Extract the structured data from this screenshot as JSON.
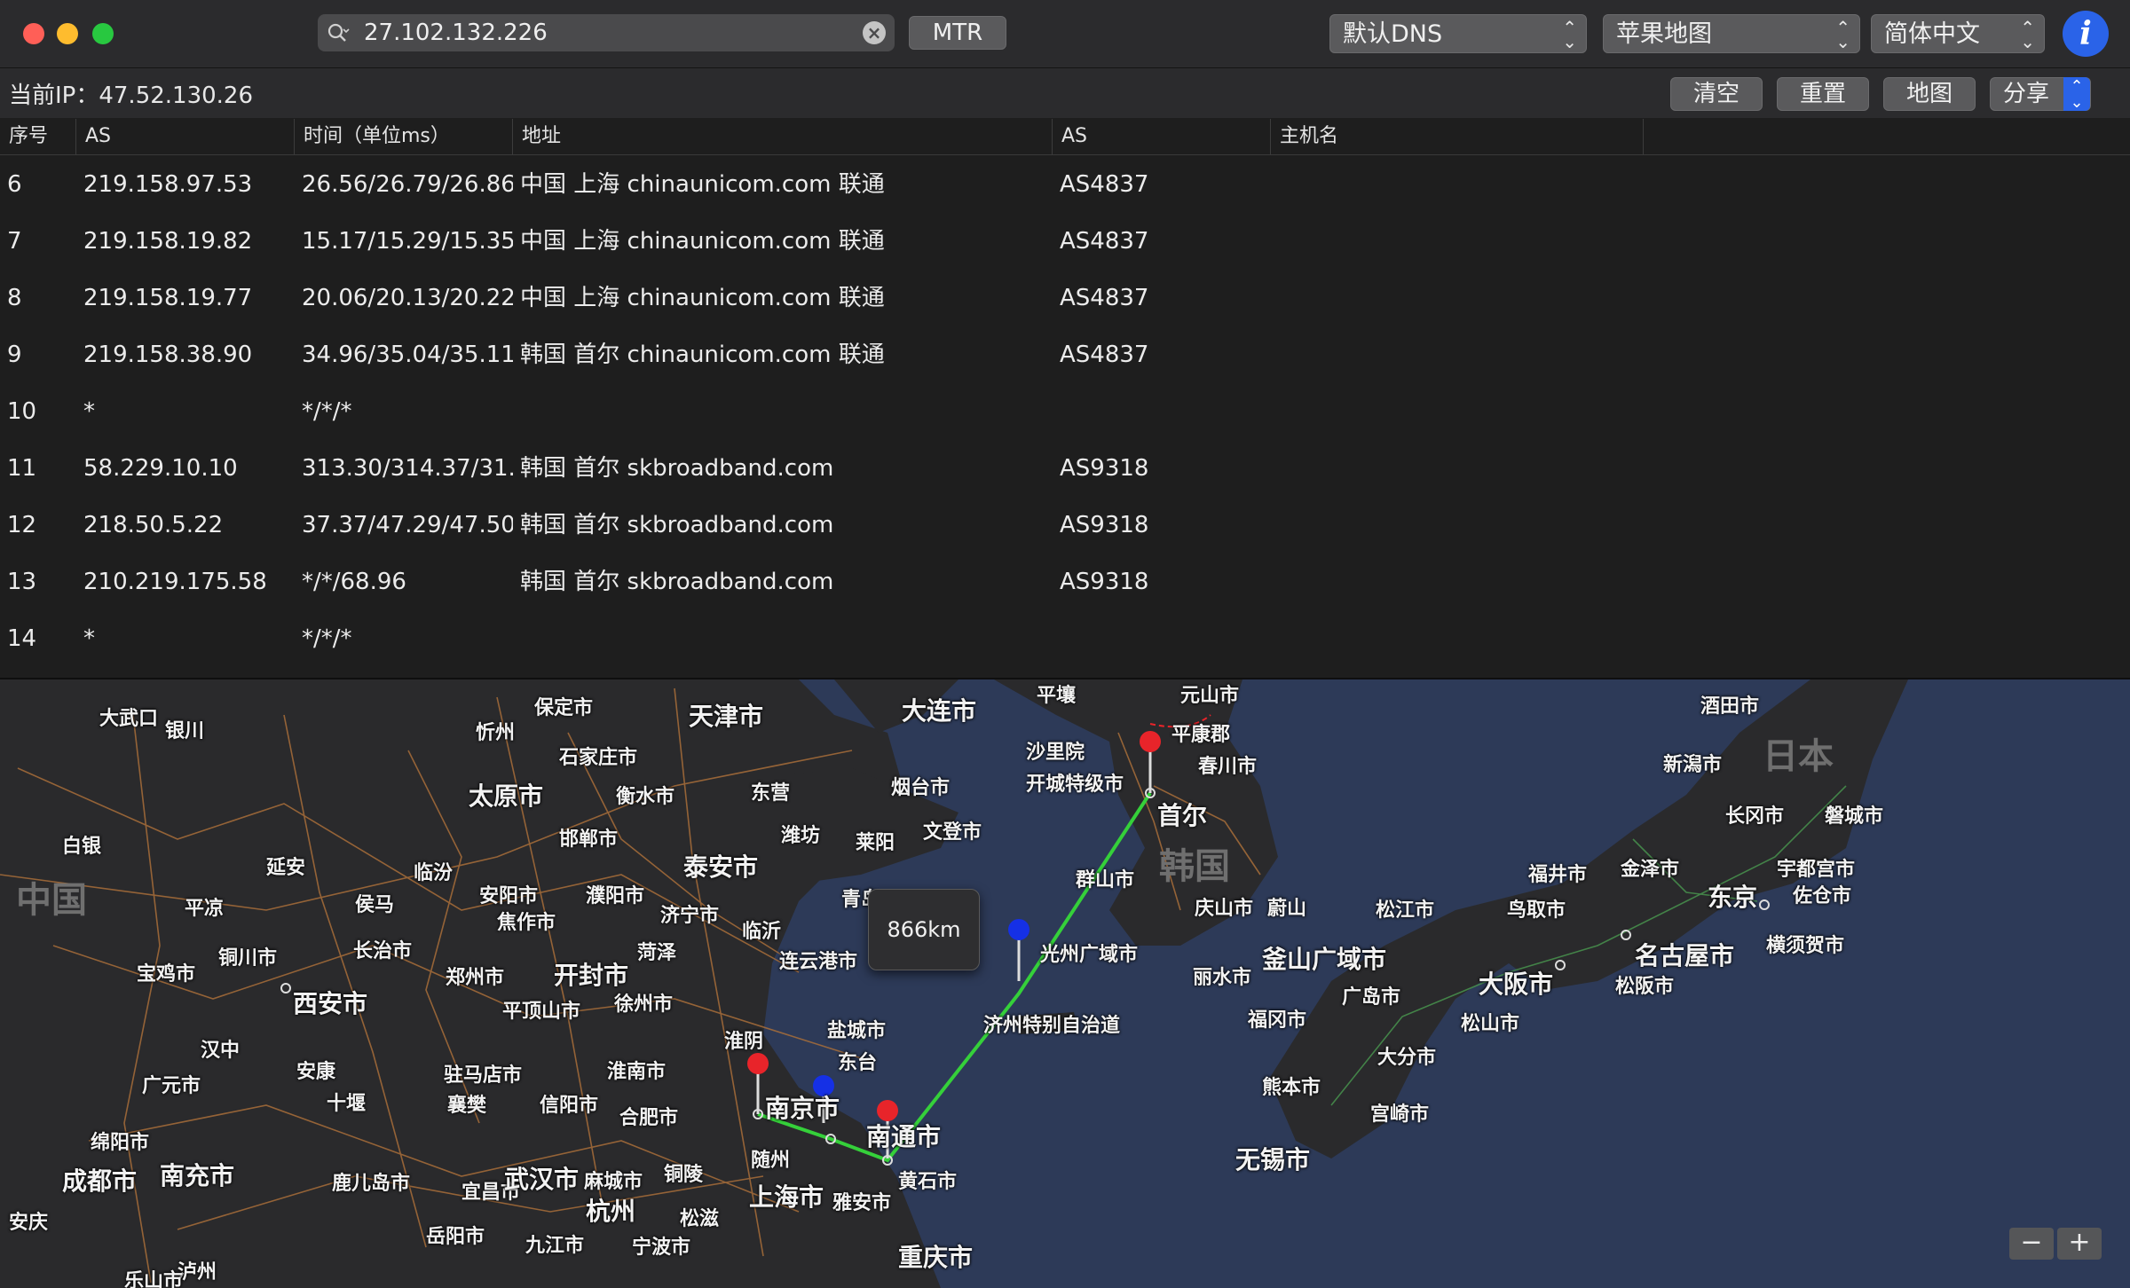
{
  "toolbar": {
    "search_value": "27.102.132.226",
    "mtr_label": "MTR",
    "dns_label": "默认DNS",
    "map_provider_label": "苹果地图",
    "language_label": "简体中文",
    "info_label": "i"
  },
  "statusbar": {
    "current_ip": "当前IP：47.52.130.26",
    "clear_label": "清空",
    "reset_label": "重置",
    "map_label": "地图",
    "share_label": "分享"
  },
  "table": {
    "headers": [
      "序号",
      "AS",
      "时间（单位ms）",
      "地址",
      "AS",
      "主机名"
    ],
    "rows": [
      {
        "n": "6",
        "ip": "219.158.97.53",
        "time": "26.56/26.79/26.86",
        "addr": "中国 上海 chinaunicom.com 联通",
        "as": "AS4837",
        "host": ""
      },
      {
        "n": "7",
        "ip": "219.158.19.82",
        "time": "15.17/15.29/15.35",
        "addr": "中国 上海 chinaunicom.com 联通",
        "as": "AS4837",
        "host": ""
      },
      {
        "n": "8",
        "ip": "219.158.19.77",
        "time": "20.06/20.13/20.22",
        "addr": "中国 上海 chinaunicom.com 联通",
        "as": "AS4837",
        "host": ""
      },
      {
        "n": "9",
        "ip": "219.158.38.90",
        "time": "34.96/35.04/35.11",
        "addr": "韩国 首尔 chinaunicom.com 联通",
        "as": "AS4837",
        "host": ""
      },
      {
        "n": "10",
        "ip": "*",
        "time": "*/*/*",
        "addr": "",
        "as": "",
        "host": ""
      },
      {
        "n": "11",
        "ip": "58.229.10.10",
        "time": "313.30/314.37/31...",
        "addr": "韩国 首尔 skbroadband.com",
        "as": "AS9318",
        "host": ""
      },
      {
        "n": "12",
        "ip": "218.50.5.22",
        "time": "37.37/47.29/47.50",
        "addr": "韩国 首尔 skbroadband.com",
        "as": "AS9318",
        "host": ""
      },
      {
        "n": "13",
        "ip": "210.219.175.58",
        "time": "*/*/68.96",
        "addr": "韩国 首尔 skbroadband.com",
        "as": "AS9318",
        "host": ""
      },
      {
        "n": "14",
        "ip": "*",
        "time": "*/*/*",
        "addr": "",
        "as": "",
        "host": ""
      }
    ]
  },
  "map": {
    "distance_label": "866km",
    "zoom_out_label": "−",
    "zoom_in_label": "+",
    "countries": [
      "中国",
      "韩国",
      "日本"
    ],
    "places": [
      "大武口",
      "银川",
      "保定市",
      "天津市",
      "大连市",
      "平壤",
      "元山市",
      "酒田市",
      "忻州",
      "石家庄市",
      "衡水市",
      "东营",
      "烟台市",
      "沙里院",
      "平康郡",
      "春川市",
      "新潟市",
      "太原市",
      "潍坊",
      "莱阳",
      "文登市",
      "开城特级市",
      "首尔",
      "长冈市",
      "磐城市",
      "白银",
      "延安",
      "临汾",
      "邯郸市",
      "泰安市",
      "群山市",
      "福井市",
      "金泽市",
      "宇都宫市",
      "平凉",
      "侯马",
      "安阳市",
      "濮阳市",
      "济宁市",
      "青岛",
      "庆山市",
      "蔚山",
      "松江市",
      "鸟取市",
      "东京",
      "佐仓市",
      "铜川市",
      "长治市",
      "焦作市",
      "菏泽",
      "临沂",
      "光州广域市",
      "釜山广域市",
      "名古屋市",
      "横须贺市",
      "宝鸡市",
      "郑州市",
      "开封市",
      "连云港市",
      "丽水市",
      "大阪市",
      "松阪市",
      "西安市",
      "平顶山市",
      "徐州市",
      "济州特别自治道",
      "广岛市",
      "汉中",
      "盐城市",
      "福冈市",
      "松山市",
      "广元市",
      "安康",
      "驻马店市",
      "淮南市",
      "淮阴",
      "东台",
      "大分市",
      "十堰",
      "襄樊",
      "信阳市",
      "南京市",
      "熊本市",
      "绵阳市",
      "合肥市",
      "南通市",
      "宫崎市",
      "成都市",
      "南充市",
      "随州",
      "无锡市",
      "鹿儿岛市",
      "宜昌市",
      "武汉市",
      "麻城市",
      "铜陵",
      "上海市",
      "黄石市",
      "杭州",
      "雅安市",
      "安庆",
      "松滋",
      "岳阳市",
      "九江市",
      "宁波市",
      "重庆市",
      "泸州",
      "乐山市"
    ],
    "route_color": "#35d03a",
    "pin_red": "#e8242a",
    "pin_blue": "#1530e6"
  }
}
